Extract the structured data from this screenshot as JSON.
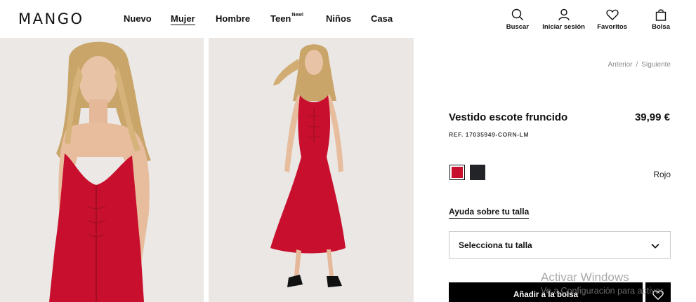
{
  "brand": {
    "logo_text": "MANGO"
  },
  "nav": {
    "items": [
      {
        "label": "Nuevo",
        "badge": ""
      },
      {
        "label": "Mujer",
        "badge": "",
        "active": true
      },
      {
        "label": "Hombre",
        "badge": ""
      },
      {
        "label": "Teen",
        "badge": "New!"
      },
      {
        "label": "Niños",
        "badge": ""
      },
      {
        "label": "Casa",
        "badge": ""
      }
    ]
  },
  "actions": {
    "search": {
      "label": "Buscar",
      "icon": "search-icon"
    },
    "login": {
      "label": "Iniciar sesión",
      "icon": "user-icon"
    },
    "favorites": {
      "label": "Favoritos",
      "icon": "heart-icon"
    },
    "bag": {
      "label": "Bolsa",
      "icon": "bag-icon"
    }
  },
  "gallery": {
    "images": [
      {
        "alt": "Model wearing red dress, close-up"
      },
      {
        "alt": "Model wearing red dress, full body"
      }
    ]
  },
  "product": {
    "pager_prev": "Anterior",
    "pager_sep": "/",
    "pager_next": "Siguiente",
    "name": "Vestido escote fruncido",
    "price": "39,99 €",
    "ref": "REF. 17035949-CORN-LM",
    "colors": [
      {
        "name": "Rojo",
        "hex": "#c8102e",
        "selected": true
      },
      {
        "name": "Negro",
        "hex": "#222428",
        "selected": false
      }
    ],
    "selected_color_name": "Rojo",
    "size_help": "Ayuda sobre tu talla",
    "size_placeholder": "Selecciona tu talla",
    "add_to_bag": "Añadir a la bolsa"
  },
  "os_watermark": {
    "line1": "Activar Windows",
    "line2": "Ve a Configuración para activar"
  },
  "colors": {
    "dress_red": "#c8102e",
    "background": "#ebe9e7",
    "text": "#111111"
  }
}
